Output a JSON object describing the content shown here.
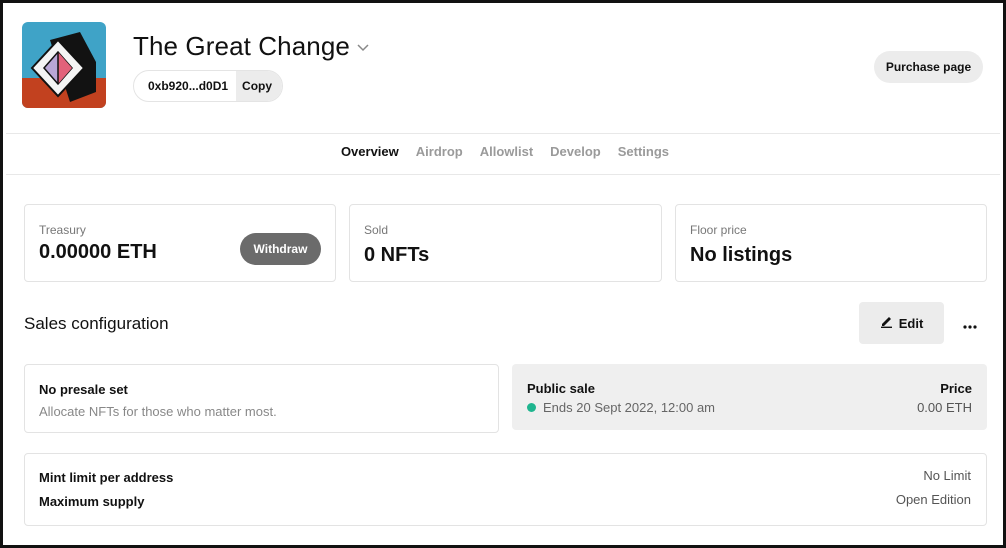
{
  "colors": {
    "accent_dot": "#1fb58f",
    "withdraw_bg": "#6b6b6b",
    "pill_bg": "#ececec"
  },
  "header": {
    "title": "The Great Change",
    "address": "0xb920...d0D1",
    "copy_label": "Copy",
    "purchase_label": "Purchase page",
    "dropdown_icon": "chevron-down-icon"
  },
  "tabs": [
    {
      "label": "Overview",
      "active": true
    },
    {
      "label": "Airdrop",
      "active": false
    },
    {
      "label": "Allowlist",
      "active": false
    },
    {
      "label": "Develop",
      "active": false
    },
    {
      "label": "Settings",
      "active": false
    }
  ],
  "stats": {
    "treasury": {
      "label": "Treasury",
      "value": "0.00000 ETH",
      "action": "Withdraw"
    },
    "sold": {
      "label": "Sold",
      "value": "0 NFTs"
    },
    "floor": {
      "label": "Floor price",
      "value": "No listings"
    }
  },
  "sales": {
    "title": "Sales configuration",
    "edit_label": "Edit",
    "presale": {
      "title": "No presale set",
      "subtitle": "Allocate NFTs for those who matter most."
    },
    "public": {
      "title": "Public sale",
      "status": "Ends 20 Sept 2022, 12:00 am",
      "price_label": "Price",
      "price_value": "0.00 ETH"
    },
    "limits": [
      {
        "label": "Mint limit per address",
        "value": "No Limit"
      },
      {
        "label": "Maximum supply",
        "value": "Open Edition"
      }
    ]
  }
}
